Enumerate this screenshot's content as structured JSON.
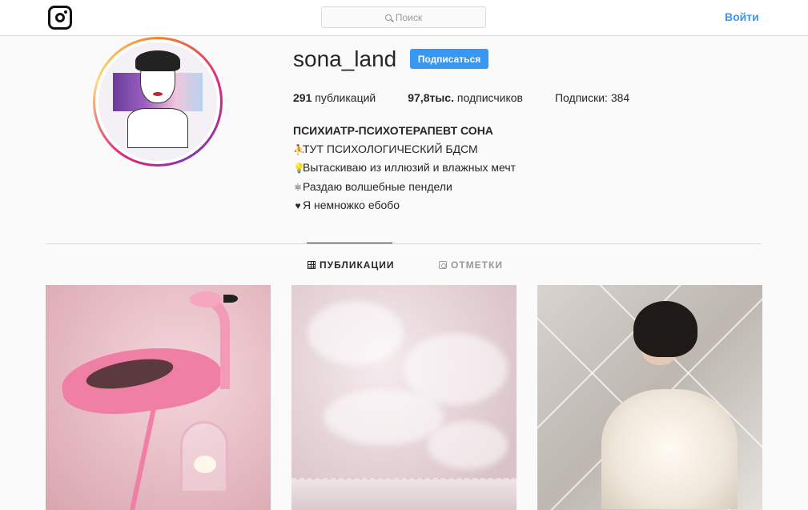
{
  "nav": {
    "search_placeholder": "Поиск",
    "login_label": "Войти"
  },
  "profile": {
    "username": "sona_land",
    "follow_label": "Подписаться",
    "stats": {
      "posts_count": "291",
      "posts_label": " публикаций",
      "followers_count": "97,8тыс.",
      "followers_label": " подписчиков",
      "following_label": "Подписки: 384"
    },
    "bio": {
      "name": "ПСИХИАТР-ПСИХОТЕРАПЕВТ СОНА",
      "lines": [
        {
          "icon": "⛹",
          "text": "ТУТ ПСИХОЛОГИЧЕСКИЙ БДСМ"
        },
        {
          "icon": "💡",
          "text": "Вытаскиваю из иллюзий и влажных мечт"
        },
        {
          "icon": "⚛",
          "text": "Раздаю волшебные пендели"
        },
        {
          "icon": "♥",
          "text": "Я немножко ебобо"
        }
      ]
    }
  },
  "tabs": {
    "posts_label": "ПУБЛИКАЦИИ",
    "tagged_label": "ОТМЕТКИ"
  },
  "colors": {
    "accent": "#3897f0",
    "text": "#262626",
    "muted": "#999999",
    "border": "#dbdbdb"
  },
  "icons": [
    "instagram-logo-icon",
    "search-icon",
    "grid-icon",
    "tag-icon"
  ]
}
